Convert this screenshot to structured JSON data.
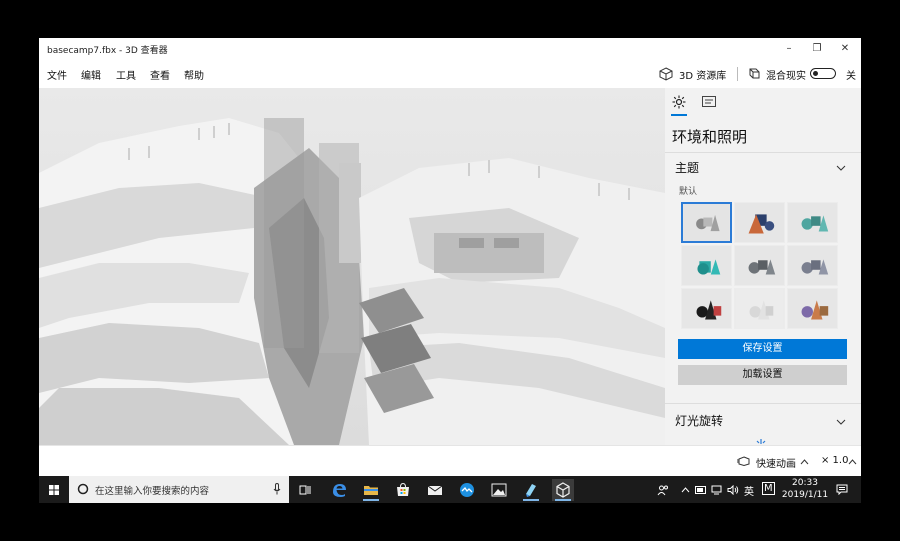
{
  "window": {
    "title": "basecamp7.fbx - 3D 查看器"
  },
  "menu": {
    "items": [
      "文件",
      "编辑",
      "工具",
      "查看",
      "帮助"
    ],
    "library": "3D 资源库",
    "mixed_reality": "混合现实",
    "toggle_state": "关"
  },
  "panel": {
    "heading": "环境和照明",
    "theme_section": "主题",
    "theme_default": "默认",
    "save_button": "保存设置",
    "load_button": "加载设置",
    "light_section": "灯光旋转"
  },
  "bottom": {
    "quick_anim": "快速动画",
    "speed": "× 1.0"
  },
  "taskbar": {
    "search_placeholder": "在这里输入你要搜索的内容",
    "lang": "英",
    "ime": "M",
    "time": "20:33",
    "date": "2019/1/11"
  },
  "colors": {
    "accent": "#0078d7",
    "taskbar": "#1b1b1b",
    "viewport_bg": "#e6e6e6"
  }
}
